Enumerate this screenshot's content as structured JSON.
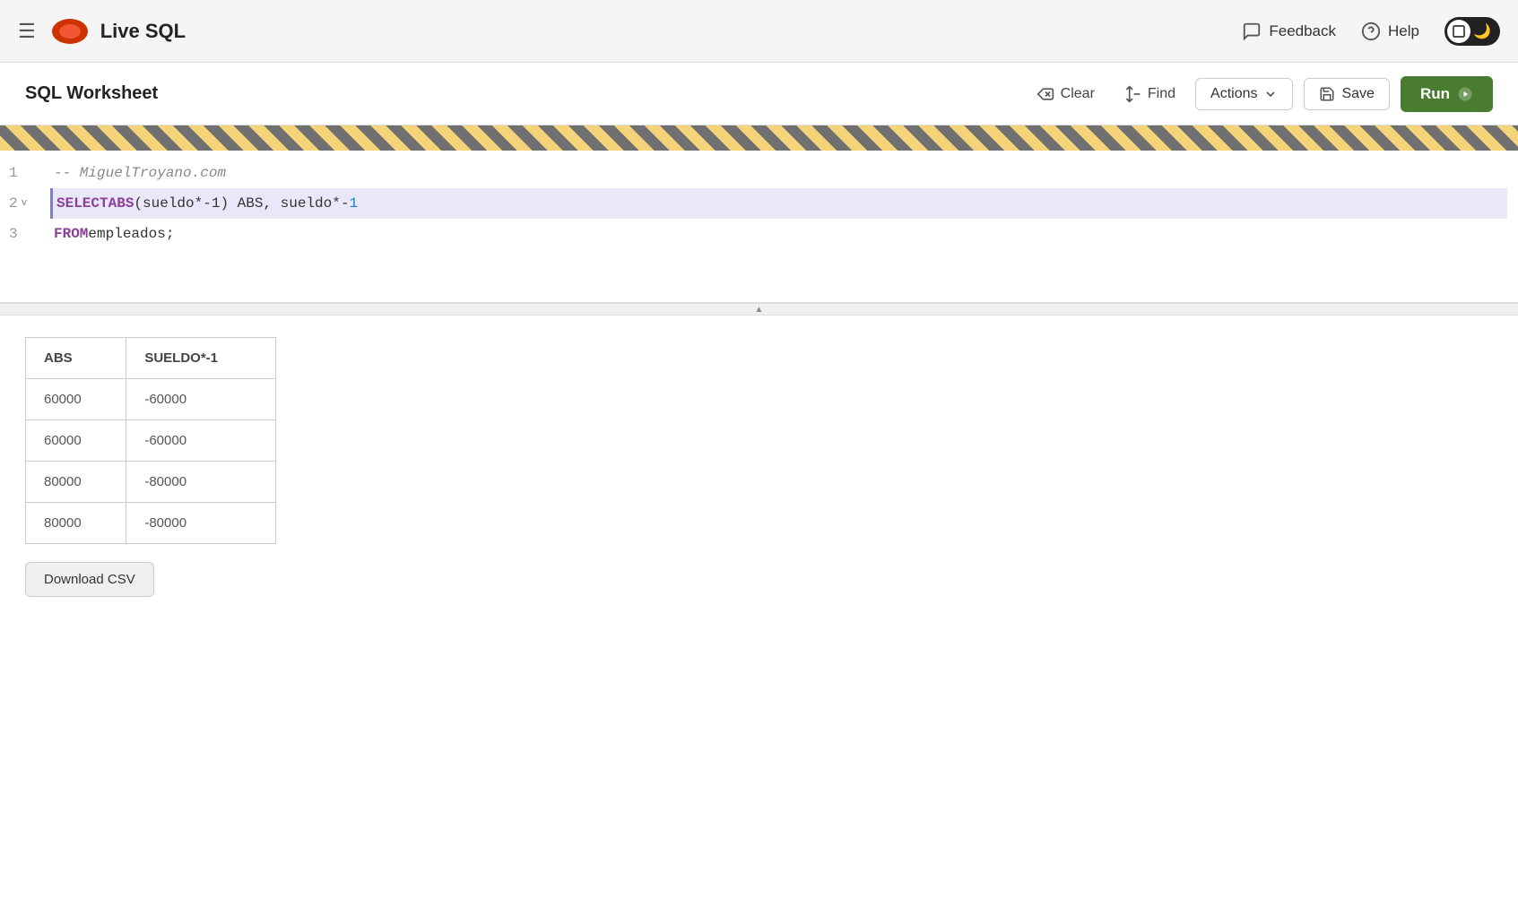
{
  "nav": {
    "hamburger_icon": "☰",
    "title": "Live SQL",
    "feedback_label": "Feedback",
    "help_label": "Help"
  },
  "worksheet": {
    "title": "SQL Worksheet",
    "clear_label": "Clear",
    "find_label": "Find",
    "actions_label": "Actions",
    "save_label": "Save",
    "run_label": "Run"
  },
  "editor": {
    "lines": [
      {
        "num": "1",
        "fold": "",
        "content": "comment",
        "text": "-- MiguelTroyano.com"
      },
      {
        "num": "2",
        "fold": "v",
        "content": "selected",
        "text": "SELECT ABS(sueldo*-1) ABS, sueldo*-1"
      },
      {
        "num": "3",
        "fold": "",
        "content": "normal",
        "text": "FROM empleados;"
      }
    ]
  },
  "results": {
    "columns": [
      "ABS",
      "SUELDO*-1"
    ],
    "rows": [
      [
        "60000",
        "-60000"
      ],
      [
        "60000",
        "-60000"
      ],
      [
        "80000",
        "-80000"
      ],
      [
        "80000",
        "-80000"
      ]
    ],
    "download_label": "Download CSV"
  }
}
